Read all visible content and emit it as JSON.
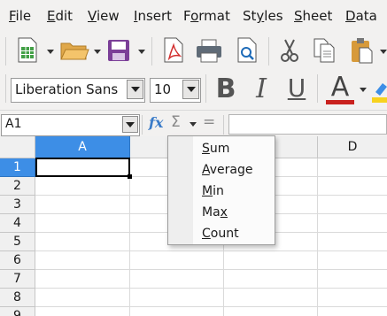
{
  "menubar": {
    "items": [
      {
        "pre": "",
        "u": "F",
        "post": "ile"
      },
      {
        "pre": "",
        "u": "E",
        "post": "dit"
      },
      {
        "pre": "",
        "u": "V",
        "post": "iew"
      },
      {
        "pre": "",
        "u": "I",
        "post": "nsert"
      },
      {
        "pre": "F",
        "u": "o",
        "post": "rmat"
      },
      {
        "pre": "St",
        "u": "y",
        "post": "les"
      },
      {
        "pre": "",
        "u": "S",
        "post": "heet"
      },
      {
        "pre": "",
        "u": "D",
        "post": "ata"
      }
    ]
  },
  "toolbar": {
    "font_name": "Liberation Sans",
    "font_size": "10",
    "bold": "B",
    "italic": "I",
    "underline": "U",
    "font_color_letter": "A",
    "font_color": "#c9211e"
  },
  "formula_bar": {
    "cell_reference": "A1",
    "function_symbol": "fx",
    "sum_symbol": "Σ",
    "equals_symbol": "="
  },
  "sheet": {
    "columns": [
      "A",
      "D"
    ],
    "rows": [
      "1",
      "2",
      "3",
      "4",
      "5",
      "6",
      "7",
      "8",
      "9"
    ],
    "active_cell": "A1",
    "accent_color": "#3d8ee6"
  },
  "sum_menu": {
    "items": [
      {
        "u": "S",
        "post": "um"
      },
      {
        "u": "A",
        "post": "verage"
      },
      {
        "u": "M",
        "post": "in"
      },
      {
        "pre": "Ma",
        "u": "x",
        "post": ""
      },
      {
        "u": "C",
        "post": "ount"
      }
    ]
  }
}
